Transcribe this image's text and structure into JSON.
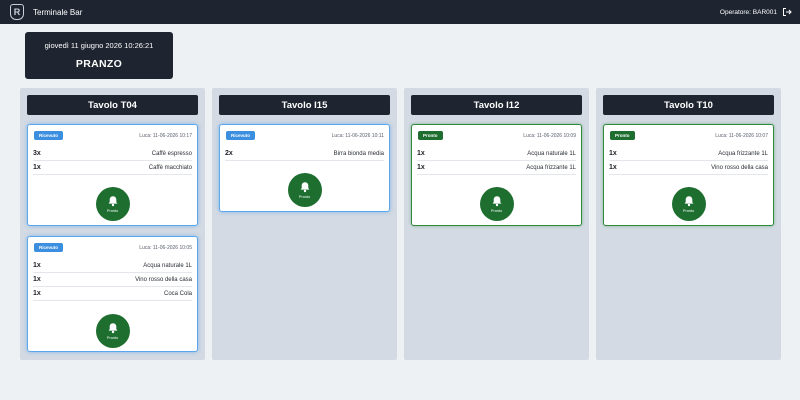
{
  "app": {
    "title": "Terminale Bar",
    "operator": "Operatore: BAR001"
  },
  "shift": {
    "datetime": "giovedì 11 giugno 2026 10:26:21",
    "name": "PRANZO"
  },
  "colors": {
    "dark": "#1e2430",
    "received": "#3b8fde",
    "ready": "#1e6e30",
    "column": "#d3dae3"
  },
  "button": {
    "ready_label": "Pronto"
  },
  "columns": [
    {
      "table": "Tavolo T04",
      "orders": [
        {
          "status": "Ricevuto",
          "meta": "Luca: 11-06-2026 10:17",
          "items": [
            {
              "qty": "3x",
              "name": "Caffè espresso"
            },
            {
              "qty": "1x",
              "name": "Caffè macchiato"
            }
          ]
        },
        {
          "status": "Ricevuto",
          "meta": "Luca: 11-06-2026 10:05",
          "items": [
            {
              "qty": "1x",
              "name": "Acqua naturale 1L"
            },
            {
              "qty": "1x",
              "name": "Vino rosso della casa"
            },
            {
              "qty": "1x",
              "name": "Coca Cola"
            }
          ]
        }
      ]
    },
    {
      "table": "Tavolo I15",
      "orders": [
        {
          "status": "Ricevuto",
          "meta": "Luca: 11-06-2026 10:11",
          "items": [
            {
              "qty": "2x",
              "name": "Birra bionda media"
            }
          ]
        }
      ]
    },
    {
      "table": "Tavolo I12",
      "orders": [
        {
          "status": "Pronto",
          "meta": "Luca: 11-06-2026 10:09",
          "items": [
            {
              "qty": "1x",
              "name": "Acqua naturale 1L"
            },
            {
              "qty": "1x",
              "name": "Acqua frizzante 1L"
            }
          ]
        }
      ]
    },
    {
      "table": "Tavolo T10",
      "orders": [
        {
          "status": "Pronto",
          "meta": "Luca: 11-06-2026 10:07",
          "items": [
            {
              "qty": "1x",
              "name": "Acqua frizzante 1L"
            },
            {
              "qty": "1x",
              "name": "Vino rosso della casa"
            }
          ]
        }
      ]
    }
  ]
}
